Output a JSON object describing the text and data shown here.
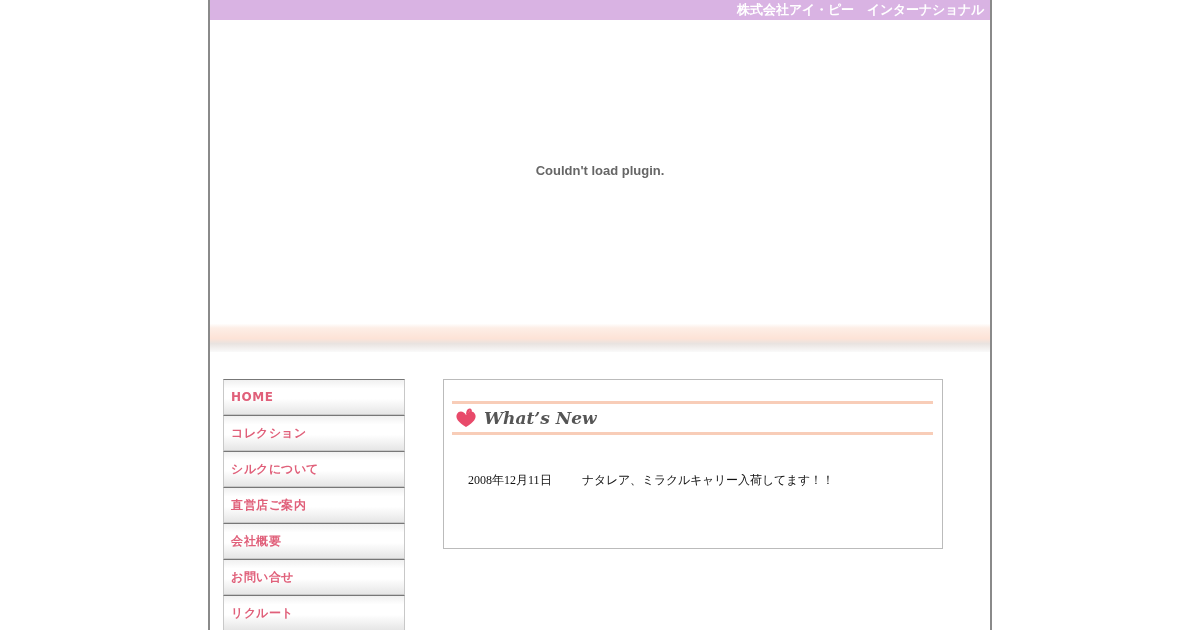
{
  "header": {
    "company": "株式会社アイ・ピー　インターナショナル"
  },
  "plugin": {
    "message": "Couldn't load plugin."
  },
  "nav": {
    "items": [
      {
        "label": "HOME"
      },
      {
        "label": "コレクション"
      },
      {
        "label": "シルクについて"
      },
      {
        "label": "直営店ご案内"
      },
      {
        "label": "会社概要"
      },
      {
        "label": "お問い合せ"
      },
      {
        "label": "リクルート"
      }
    ]
  },
  "news": {
    "title": "What’s New",
    "entries": [
      {
        "date": "2008年12月11日",
        "text": "ナタレア、ミラクルキャリー入荷してます！！"
      }
    ]
  }
}
